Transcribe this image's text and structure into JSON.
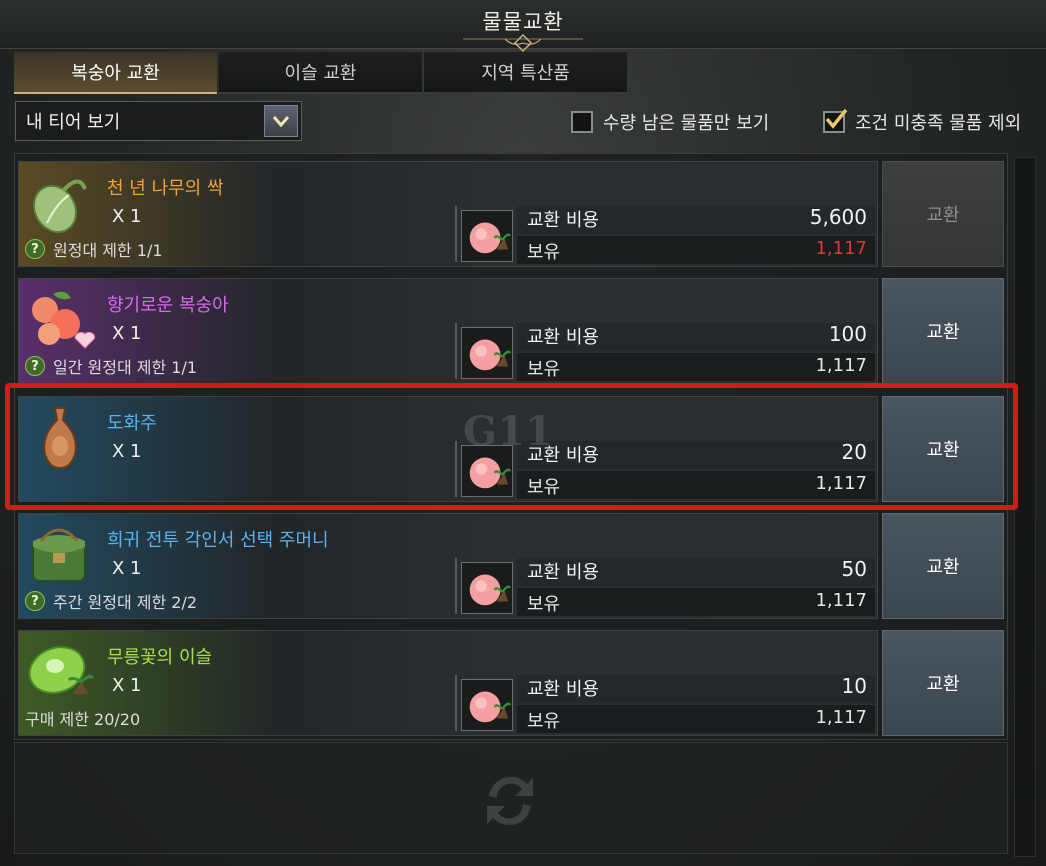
{
  "window": {
    "title": "물물교환"
  },
  "tabs": [
    {
      "label": "복숭아 교환",
      "active": true
    },
    {
      "label": "이슬 교환",
      "active": false
    },
    {
      "label": "지역 특산품",
      "active": false
    }
  ],
  "toolbar": {
    "tier_select": {
      "value": "내 티어 보기"
    },
    "filter_remaining": {
      "label": "수량 남은 물품만 보기",
      "checked": false
    },
    "filter_unmet": {
      "label": "조건 미충족 물품 제외",
      "checked": true
    }
  },
  "common": {
    "cost_label": "교환 비용",
    "owned_label": "보유",
    "exchange_label": "교환",
    "help_glyph": "?",
    "cost_icon": "peach-icon"
  },
  "items": [
    {
      "name": "천 년 나무의 싹",
      "name_color": "#f0a23a",
      "qty": "X 1",
      "limit": "원정대 제한 1/1",
      "has_help": true,
      "cost": "5,600",
      "owned": "1,117",
      "owned_color": "#e03a3a",
      "button_enabled": false,
      "icon": "sprout-icon",
      "accent": "rgba(140,110,40,0.55)"
    },
    {
      "name": "향기로운 복숭아",
      "name_color": "#d86bf0",
      "qty": "X 1",
      "limit": "일간 원정대 제한 1/1",
      "has_help": true,
      "cost": "100",
      "owned": "1,117",
      "owned_color": "#e6e6e6",
      "button_enabled": true,
      "icon": "peaches-icon",
      "accent": "rgba(140,60,170,0.55)"
    },
    {
      "name": "도화주",
      "name_color": "#5ab2f0",
      "qty": "X 1",
      "limit": "",
      "has_help": false,
      "cost": "20",
      "owned": "1,117",
      "owned_color": "#e6e6e6",
      "button_enabled": true,
      "icon": "vase-icon",
      "accent": "rgba(40,110,150,0.55)"
    },
    {
      "name": "희귀 전투 각인서 선택 주머니",
      "name_color": "#5ab2f0",
      "qty": "X 1",
      "limit": "주간 원정대 제한 2/2",
      "has_help": true,
      "cost": "50",
      "owned": "1,117",
      "owned_color": "#e6e6e6",
      "button_enabled": true,
      "icon": "pouch-icon",
      "accent": "rgba(40,110,150,0.55)"
    },
    {
      "name": "무릉꽃의 이슬",
      "name_color": "#a9e04a",
      "qty": "X 1",
      "limit": "구매 제한 20/20",
      "has_help": false,
      "cost": "10",
      "owned": "1,117",
      "owned_color": "#e6e6e6",
      "button_enabled": true,
      "icon": "dew-icon",
      "accent": "rgba(90,140,40,0.55)"
    }
  ],
  "watermark": "G11"
}
